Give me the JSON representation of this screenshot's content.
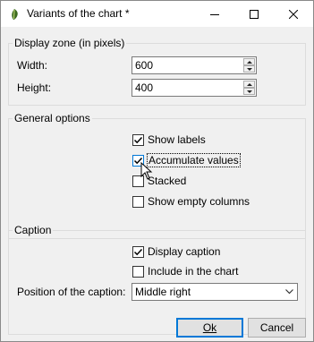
{
  "window": {
    "title": "Variants of the chart *",
    "icon": "leaf-app-icon"
  },
  "display_zone": {
    "legend": "Display zone (in pixels)",
    "width_label": "Width:",
    "width_value": "600",
    "height_label": "Height:",
    "height_value": "400"
  },
  "general_options": {
    "legend": "General options",
    "show_labels": {
      "label": "Show labels",
      "checked": true
    },
    "accumulate_values": {
      "label": "Accumulate values",
      "checked": true
    },
    "stacked": {
      "label": "Stacked",
      "checked": false
    },
    "show_empty_columns": {
      "label": "Show empty columns",
      "checked": false
    }
  },
  "caption": {
    "legend": "Caption",
    "display_caption": {
      "label": "Display caption",
      "checked": true
    },
    "include_in_chart": {
      "label": "Include in the chart",
      "checked": false
    },
    "position_label": "Position of the caption:",
    "position_value": "Middle right"
  },
  "buttons": {
    "ok": "Ok",
    "cancel": "Cancel"
  },
  "colors": {
    "accent": "#0078d7",
    "dialog_bg": "#f0f0f0"
  }
}
